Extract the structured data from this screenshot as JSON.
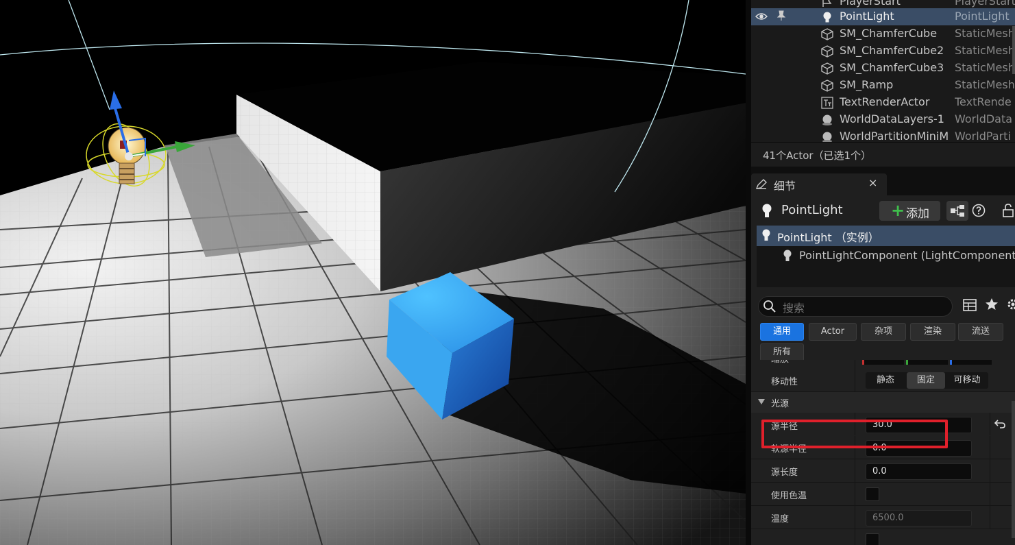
{
  "outliner": {
    "rows": [
      {
        "name": "PlayerStart",
        "type": "PlayerStart",
        "icon": "flag-icon",
        "selected": false
      },
      {
        "name": "PointLight",
        "type": "PointLight",
        "icon": "lightbulb-icon",
        "selected": true
      },
      {
        "name": "SM_ChamferCube",
        "type": "StaticMesh",
        "icon": "cube-icon",
        "selected": false
      },
      {
        "name": "SM_ChamferCube2",
        "type": "StaticMesh",
        "icon": "cube-icon",
        "selected": false
      },
      {
        "name": "SM_ChamferCube3",
        "type": "StaticMesh",
        "icon": "cube-icon",
        "selected": false
      },
      {
        "name": "SM_Ramp",
        "type": "StaticMesh",
        "icon": "cube-icon",
        "selected": false
      },
      {
        "name": "TextRenderActor",
        "type": "TextRende",
        "icon": "text-render-icon",
        "selected": false
      },
      {
        "name": "WorldDataLayers-1",
        "type": "WorldData",
        "icon": "sphere-icon",
        "selected": false
      },
      {
        "name": "WorldPartitionMiniM",
        "type": "WorldParti",
        "icon": "sphere-icon",
        "selected": false
      }
    ],
    "footer": "41个Actor（已选1个）"
  },
  "details": {
    "tab_label": "细节",
    "tab_close": "×",
    "actor_name": "PointLight",
    "add_button": "添加",
    "add_plus": "+",
    "components": [
      {
        "label": "PointLight （实例）",
        "selected": true
      },
      {
        "label": "PointLightComponent (LightComponent",
        "selected": false
      }
    ],
    "search_placeholder": "搜索",
    "filters": [
      "通用",
      "Actor",
      "杂项",
      "渲染",
      "流送",
      "所有"
    ],
    "active_filter": "通用",
    "properties": {
      "partial_row_label": "缩放",
      "mobility_label": "移动性",
      "mobility_options": [
        "静态",
        "固定",
        "可移动"
      ],
      "mobility_selected": "固定",
      "section_light": "光源",
      "source_radius_label": "源半径",
      "source_radius_value": "30.0",
      "soft_source_radius_label": "软源半径",
      "soft_source_radius_value": "0.0",
      "source_length_label": "源长度",
      "source_length_value": "0.0",
      "use_temperature_label": "使用色温",
      "temperature_label": "温度",
      "temperature_value": "6500.0"
    }
  },
  "colors": {
    "selection": "#3a4d66",
    "accent_blue": "#1a73e0",
    "highlight_red": "#e0202b",
    "cube_blue": "#2d8ee8"
  }
}
